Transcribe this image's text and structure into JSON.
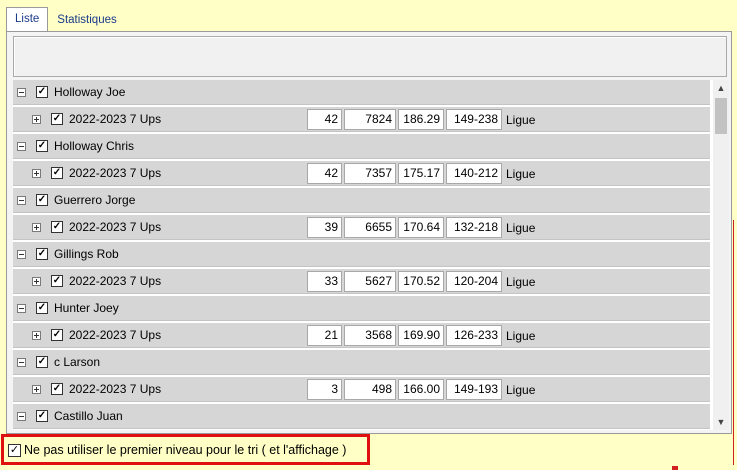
{
  "tabs": [
    {
      "label": "Liste",
      "active": true
    },
    {
      "label": "Statistiques",
      "active": false
    }
  ],
  "rows": [
    {
      "type": "parent",
      "label": "Holloway Joe",
      "checked": true
    },
    {
      "type": "child",
      "label": "2022-2023 7 Ups",
      "checked": true,
      "games": "42",
      "pins": "7824",
      "avg": "186.29",
      "range": "149-238",
      "kind": "Ligue"
    },
    {
      "type": "parent",
      "label": "Holloway Chris",
      "checked": true
    },
    {
      "type": "child",
      "label": "2022-2023 7 Ups",
      "checked": true,
      "games": "42",
      "pins": "7357",
      "avg": "175.17",
      "range": "140-212",
      "kind": "Ligue"
    },
    {
      "type": "parent",
      "label": "Guerrero Jorge",
      "checked": true
    },
    {
      "type": "child",
      "label": "2022-2023 7 Ups",
      "checked": true,
      "games": "39",
      "pins": "6655",
      "avg": "170.64",
      "range": "132-218",
      "kind": "Ligue"
    },
    {
      "type": "parent",
      "label": "Gillings Rob",
      "checked": true
    },
    {
      "type": "child",
      "label": "2022-2023 7 Ups",
      "checked": true,
      "games": "33",
      "pins": "5627",
      "avg": "170.52",
      "range": "120-204",
      "kind": "Ligue"
    },
    {
      "type": "parent",
      "label": "Hunter Joey",
      "checked": true
    },
    {
      "type": "child",
      "label": "2022-2023 7 Ups",
      "checked": true,
      "games": "21",
      "pins": "3568",
      "avg": "169.90",
      "range": "126-233",
      "kind": "Ligue"
    },
    {
      "type": "parent",
      "label": "c Larson",
      "checked": true
    },
    {
      "type": "child",
      "label": "2022-2023 7 Ups",
      "checked": true,
      "games": "3",
      "pins": "498",
      "avg": "166.00",
      "range": "149-193",
      "kind": "Ligue"
    },
    {
      "type": "parent",
      "label": "Castillo Juan",
      "checked": true
    }
  ],
  "bottom_option": {
    "label": "Ne pas utiliser le premier niveau pour le tri ( et l'affichage )",
    "checked": true
  },
  "icons": {
    "check": "✓",
    "scroll_up": "▲",
    "scroll_down": "▼"
  },
  "colors": {
    "window_bg": "#ffffc6",
    "row_bg": "#d6d6d6",
    "highlight_border": "#e01010",
    "tab_text": "#1a3a8a"
  }
}
